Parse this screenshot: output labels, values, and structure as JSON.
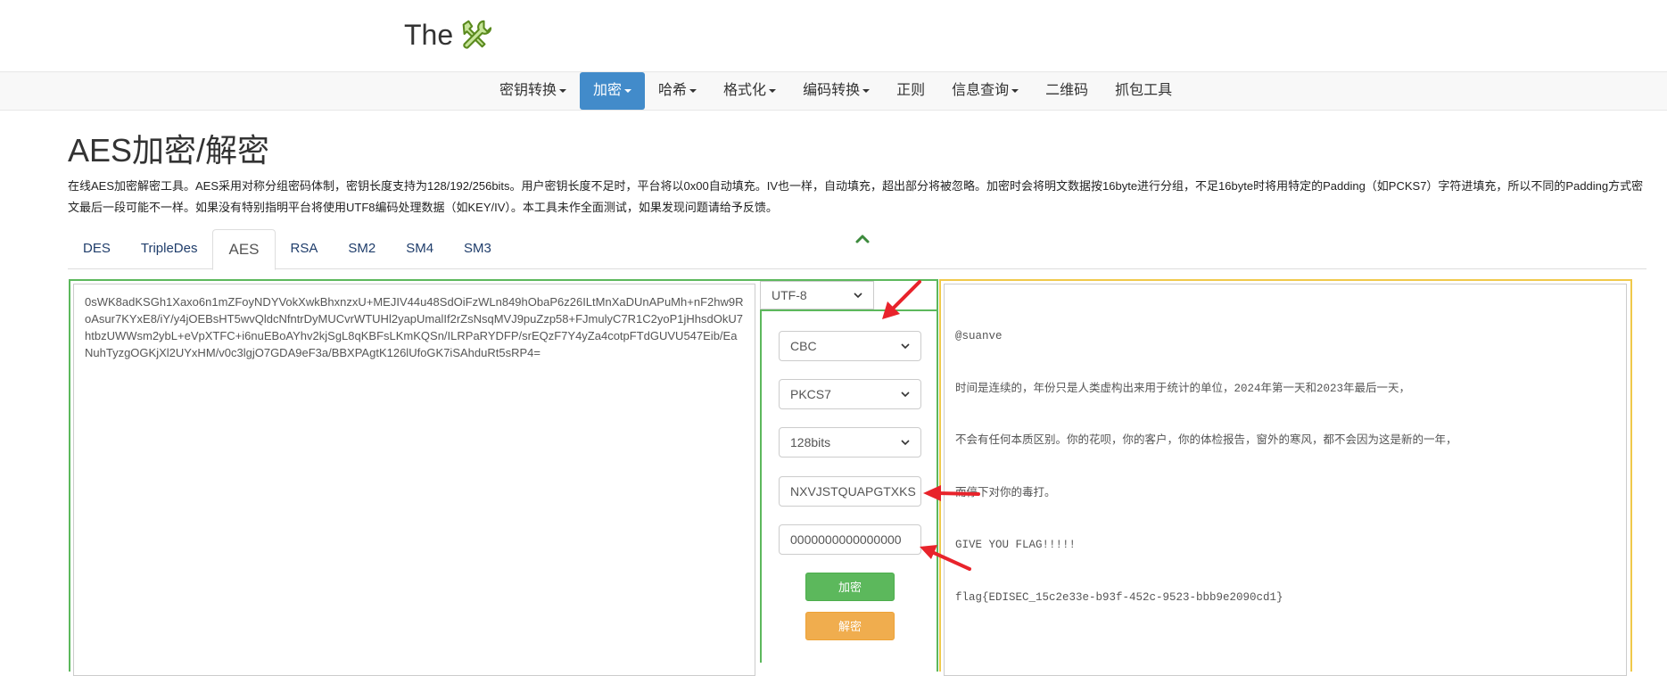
{
  "header": {
    "brand_text": "The"
  },
  "nav": {
    "items": [
      {
        "label": "密钥转换",
        "caret": true,
        "active": false
      },
      {
        "label": "加密",
        "caret": true,
        "active": true
      },
      {
        "label": "哈希",
        "caret": true,
        "active": false
      },
      {
        "label": "格式化",
        "caret": true,
        "active": false
      },
      {
        "label": "编码转换",
        "caret": true,
        "active": false
      },
      {
        "label": "正则",
        "caret": false,
        "active": false
      },
      {
        "label": "信息查询",
        "caret": true,
        "active": false
      },
      {
        "label": "二维码",
        "caret": false,
        "active": false
      },
      {
        "label": "抓包工具",
        "caret": false,
        "active": false
      }
    ]
  },
  "page": {
    "title": "AES加密/解密",
    "description": "在线AES加密解密工具。AES采用对称分组密码体制，密钥长度支持为128/192/256bits。用户密钥长度不足时，平台将以0x00自动填充。IV也一样，自动填充，超出部分将被忽略。加密时会将明文数据按16byte进行分组，不足16byte时将用特定的Padding（如PCKS7）字符进填充，所以不同的Padding方式密文最后一段可能不一样。如果没有特别指明平台将使用UTF8编码处理数据（如KEY/IV）。本工具未作全面测试，如果发现问题请给予反馈。"
  },
  "tabs": [
    {
      "label": "DES",
      "active": false
    },
    {
      "label": "TripleDes",
      "active": false
    },
    {
      "label": "AES",
      "active": true
    },
    {
      "label": "RSA",
      "active": false
    },
    {
      "label": "SM2",
      "active": false
    },
    {
      "label": "SM4",
      "active": false
    },
    {
      "label": "SM3",
      "active": false
    }
  ],
  "input": {
    "text": "0sWK8adKSGh1Xaxo6n1mZFoyNDYVokXwkBhxnzxU+MEJIV44u48SdOiFzWLn849hObaP6z26ILtMnXaDUnAPuMh+nF2hw9RoAsur7KYxE8/iY/y4jOEBsHT5wvQldcNfntrDyMUCvrWTUHl2yapUmalIf2rZsNsqMVJ9puZzp58+FJmulyC7R1C2yoP1jHhsdOkU7htbzUWWsm2ybL+eVpXTFC+i6nuEBoAYhv2kjSgL8qKBFsLKmKQSn/ILRPaRYDFP/srEQzF7Y4yZa4cotpFTdGUVU547Eib/EaNuhTyzgOGKjXl2UYxHM/v0c3lgjO7GDA9eF3a/BBXPAgtK126lUfoGK7iSAhduRt5sRP4="
  },
  "controls": {
    "charset": "UTF-8",
    "mode": "CBC",
    "padding": "PKCS7",
    "key_size": "128bits",
    "key": "NXVJSTQUAPGTXKS",
    "iv": "0000000000000000",
    "encrypt_label": "加密",
    "decrypt_label": "解密"
  },
  "output": {
    "lines": [
      "@suanve",
      "时间是连续的，年份只是人类虚构出来用于统计的单位，2024年第一天和2023年最后一天，",
      "不会有任何本质区别。你的花呗，你的客户，你的体检报告，窗外的寒风，都不会因为这是新的一年，",
      "而停下对你的毒打。",
      "GIVE YOU FLAG!!!!!",
      "flag{EDISEC_15c2e33e-b93f-452c-9523-bbb9e2090cd1}"
    ]
  },
  "colors": {
    "nav_active": "#428bca",
    "encrypt_button": "#5cb85c",
    "decrypt_button": "#f0ad4e",
    "left_panel_border": "#5cb85c",
    "right_panel_border": "#f0c94a",
    "annotation_arrow": "#e8232b"
  }
}
